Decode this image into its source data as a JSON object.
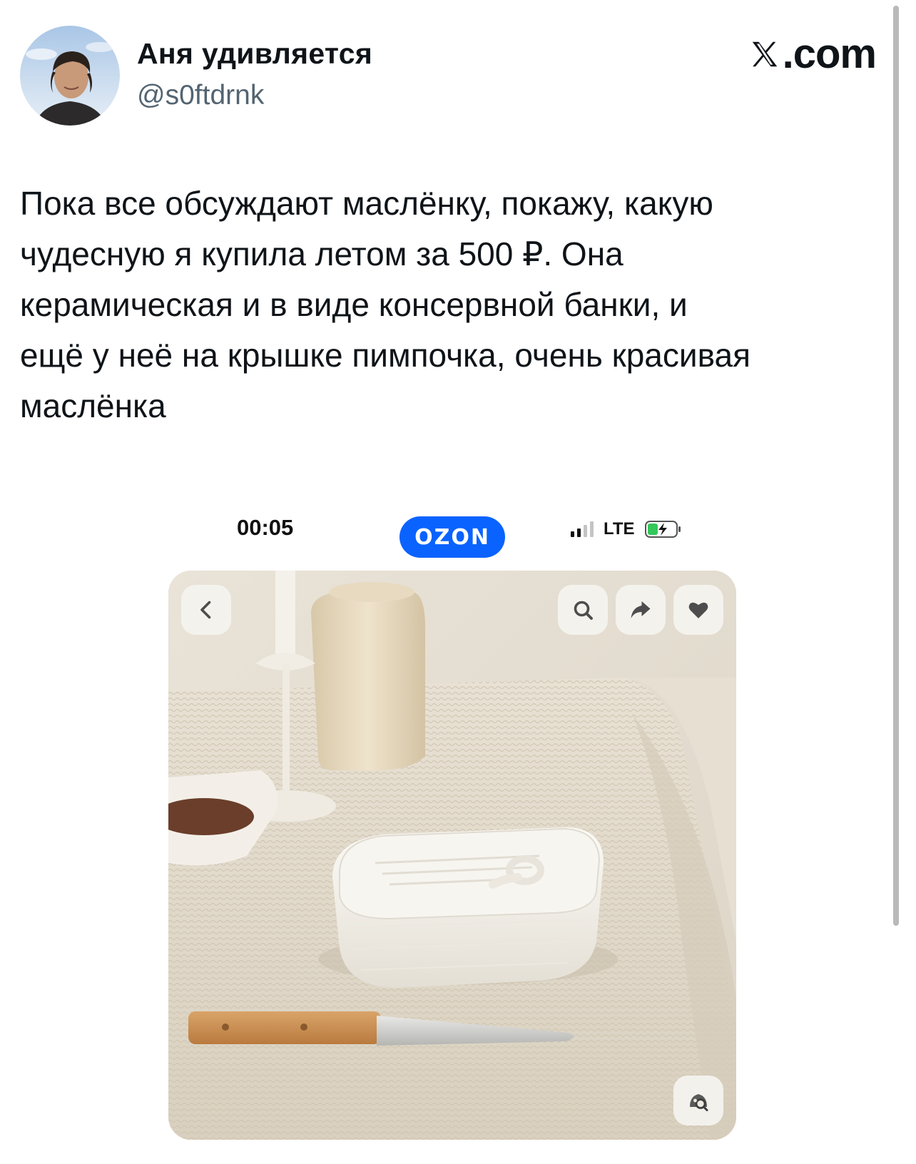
{
  "tweet": {
    "author_name": "Аня удивляется",
    "author_handle": "@s0ftdrnk",
    "site_label": ".com",
    "text": "Пока все обсуждают маслёнку, покажу, какую\nчудесную я купила летом за 500 ₽. Она\nкерамическая и в виде консервной банки, и\nещё у неё на крышке пимпочка, очень красивая\nмаслёнка"
  },
  "screenshot": {
    "status_time": "00:05",
    "app_badge": "OZON",
    "network_label": "LTE",
    "signal_bars": 2,
    "battery_charging": true
  },
  "colors": {
    "ozon_blue": "#0a63ff",
    "handle_gray": "#536471",
    "text": "#0f1419"
  },
  "icons": [
    "x-logo-icon",
    "chevron-left-icon",
    "search-icon",
    "share-arrow-icon",
    "heart-icon",
    "visual-search-icon",
    "battery-charging-icon",
    "signal-icon"
  ]
}
